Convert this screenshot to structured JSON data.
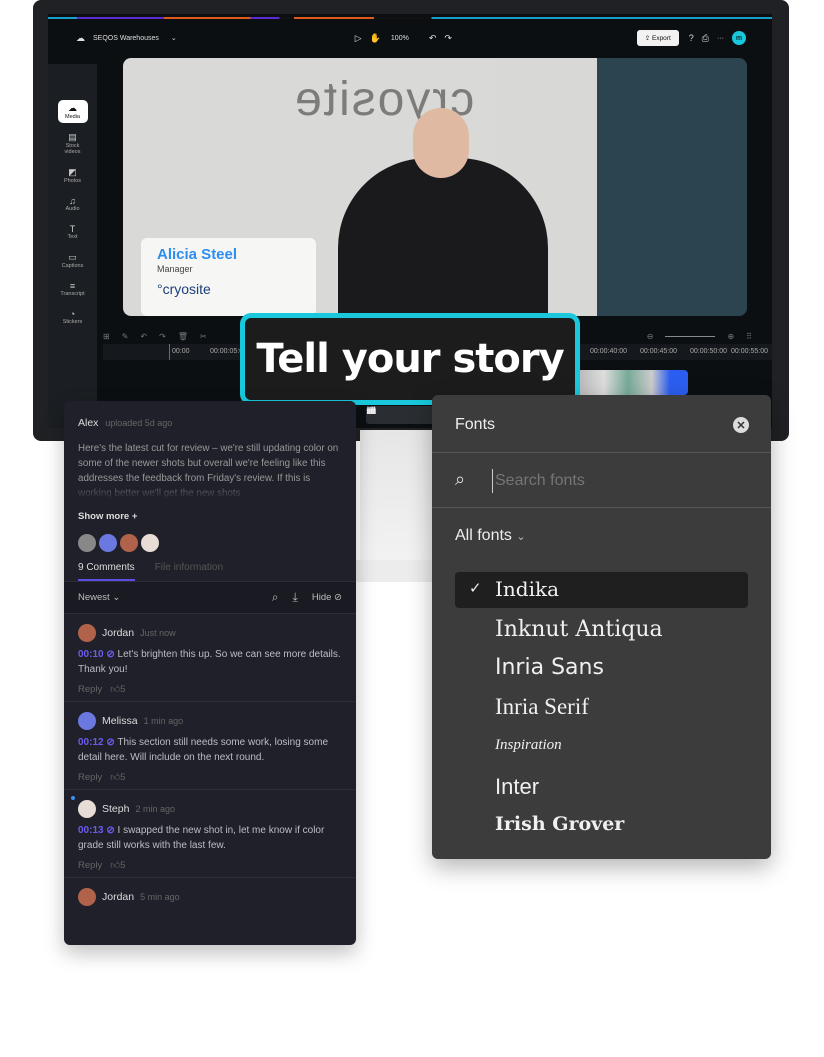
{
  "app": {
    "project_title": "SEQOS Warehouses",
    "zoom": "100%",
    "export_label": "Export",
    "avatar_initial": "m"
  },
  "sidebar": {
    "items": [
      {
        "label": "Media",
        "icon": "cloud-upload-icon",
        "active": true
      },
      {
        "label": "Stock videos",
        "icon": "film-icon"
      },
      {
        "label": "Photos",
        "icon": "image-icon"
      },
      {
        "label": "Audio",
        "icon": "music-icon"
      },
      {
        "label": "Text",
        "icon": "text-icon"
      },
      {
        "label": "Captions",
        "icon": "captions-icon"
      },
      {
        "label": "Transcript",
        "icon": "transcript-icon"
      },
      {
        "label": "Stickers",
        "icon": "sticker-icon"
      }
    ]
  },
  "video": {
    "lower_third_name": "Alicia Steel",
    "lower_third_title": "Manager",
    "logo_text": "°cryosite",
    "wall_text": "cryosite"
  },
  "timeline": {
    "ticks": [
      "00:00",
      "00:00:05:00",
      "00:00:40:00",
      "00:00:45:00",
      "00:00:50:00",
      "00:00:55:00"
    ]
  },
  "badge": {
    "text": "Tell your story",
    "border_color": "#19c8dc"
  },
  "comments_panel": {
    "uploader": "Alex",
    "uploaded": "uploaded 5d ago",
    "description": "Here's the latest cut for review – we're still updating color on some of the newer shots but overall we're feeling like this addresses the feedback from Friday's review. If this is working better we'll get the new shots",
    "show_more": "Show more +",
    "tabs": [
      "9 Comments",
      "File information"
    ],
    "sort": "Newest",
    "hide_label": "Hide",
    "reply_label": "Reply",
    "comments": [
      {
        "author": "Jordan",
        "time": "Just now",
        "timestamp": "00:10",
        "text": "Let's brighten this up. So we can see more details. Thank you!",
        "likes": "5"
      },
      {
        "author": "Melissa",
        "time": "1 min ago",
        "timestamp": "00:12",
        "text": "This section still needs some work, losing some detail here. Will include on the next round.",
        "likes": "5"
      },
      {
        "author": "Steph",
        "time": "2 min ago",
        "timestamp": "00:13",
        "text": "I swapped the new shot in, let me know if color grade still works with the last few.",
        "likes": "5"
      },
      {
        "author": "Jordan",
        "time": "5 min ago"
      }
    ],
    "accent": "#6b5cf0"
  },
  "fonts_panel": {
    "title": "Fonts",
    "search_placeholder": "Search fonts",
    "filter": "All fonts",
    "fonts": [
      {
        "name": "Indika",
        "selected": true
      },
      {
        "name": "Inknut Antiqua"
      },
      {
        "name": "Inria Sans"
      },
      {
        "name": "Inria Serif"
      },
      {
        "name": "Inspiration"
      },
      {
        "name": "Inter"
      },
      {
        "name": "Irish Grover"
      }
    ]
  }
}
